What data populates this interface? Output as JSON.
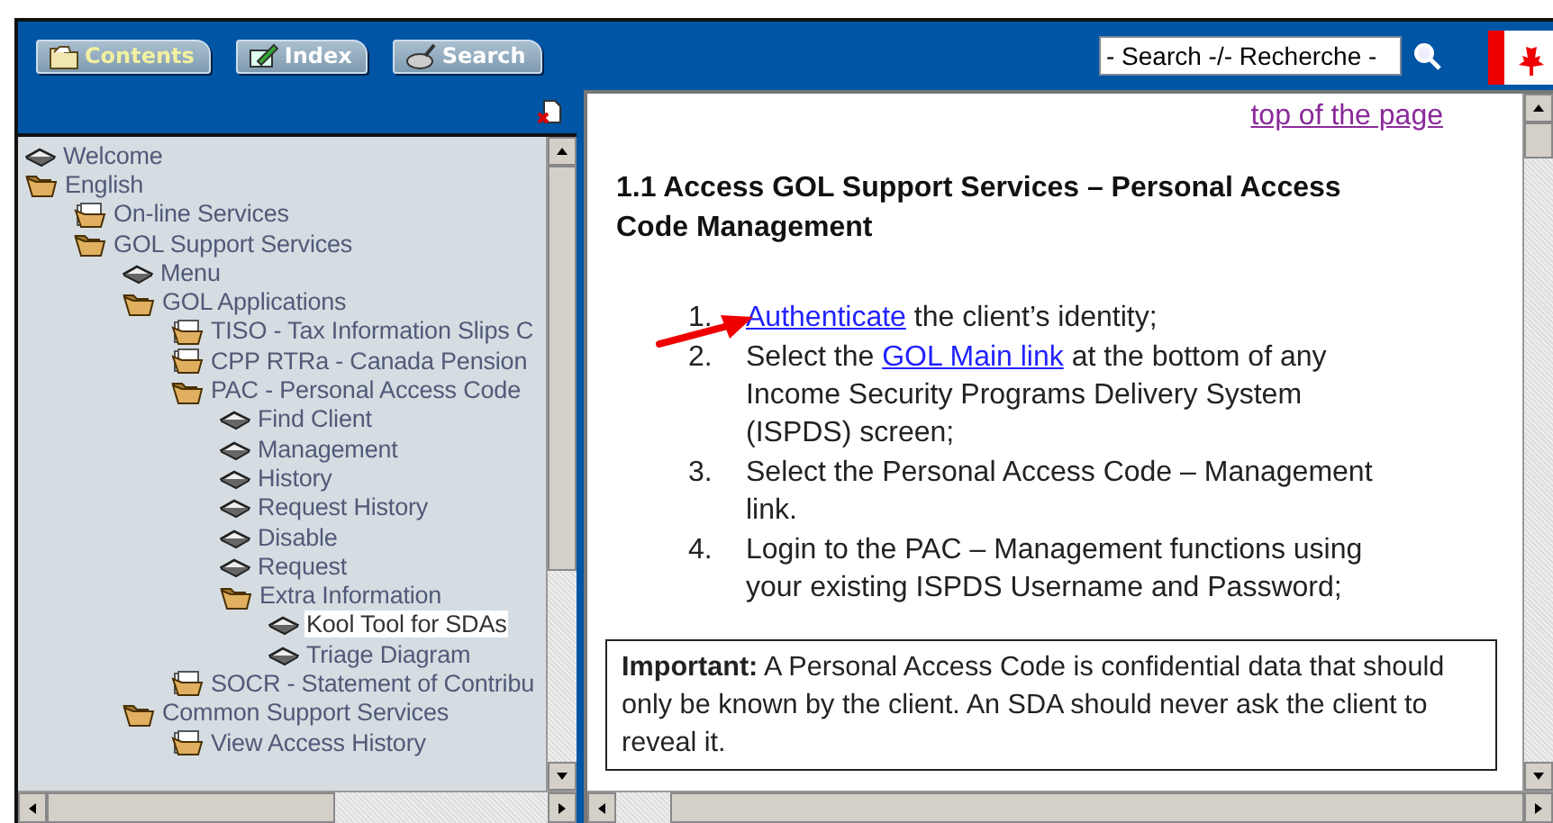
{
  "toolbar": {
    "tabs": [
      {
        "label": "Contents",
        "selected": true
      },
      {
        "label": "Index",
        "selected": false
      },
      {
        "label": "Search",
        "selected": false
      }
    ],
    "search": {
      "value": "- Search -/- Recherche -"
    }
  },
  "sidebar": {
    "tree": [
      {
        "label": "Welcome",
        "kind": "page",
        "selected": false
      },
      {
        "label": "English",
        "kind": "folder",
        "expanded": true,
        "selected": false,
        "children": [
          {
            "label": "On-line Services",
            "kind": "folder",
            "expanded": false,
            "selected": false
          },
          {
            "label": "GOL Support Services",
            "kind": "folder",
            "expanded": true,
            "selected": false,
            "children": [
              {
                "label": "Menu",
                "kind": "page",
                "selected": false
              },
              {
                "label": "GOL Applications",
                "kind": "folder",
                "expanded": true,
                "selected": false,
                "children": [
                  {
                    "label": "TISO - Tax Information Slips C",
                    "kind": "folder",
                    "expanded": false,
                    "selected": false
                  },
                  {
                    "label": "CPP RTRa - Canada Pension",
                    "kind": "folder",
                    "expanded": false,
                    "selected": false
                  },
                  {
                    "label": "PAC - Personal Access Code",
                    "kind": "folder",
                    "expanded": true,
                    "selected": false,
                    "children": [
                      {
                        "label": "Find Client",
                        "kind": "page",
                        "selected": false
                      },
                      {
                        "label": "Management",
                        "kind": "page",
                        "selected": false
                      },
                      {
                        "label": "History",
                        "kind": "page",
                        "selected": false
                      },
                      {
                        "label": "Request History",
                        "kind": "page",
                        "selected": false
                      },
                      {
                        "label": "Disable",
                        "kind": "page",
                        "selected": false
                      },
                      {
                        "label": "Request",
                        "kind": "page",
                        "selected": false
                      },
                      {
                        "label": "Extra Information",
                        "kind": "folder",
                        "expanded": true,
                        "selected": false,
                        "children": [
                          {
                            "label": "Kool Tool for SDAs",
                            "kind": "page",
                            "selected": true
                          },
                          {
                            "label": "Triage Diagram",
                            "kind": "page",
                            "selected": false
                          }
                        ]
                      }
                    ]
                  },
                  {
                    "label": "SOCR - Statement of Contribu",
                    "kind": "folder",
                    "expanded": false,
                    "selected": false
                  }
                ]
              },
              {
                "label": "Common Support Services",
                "kind": "folder",
                "expanded": true,
                "selected": false,
                "children": [
                  {
                    "label": "View Access History",
                    "kind": "folder",
                    "expanded": false,
                    "selected": false
                  }
                ]
              }
            ]
          }
        ]
      }
    ]
  },
  "content": {
    "top_link": "top of the page",
    "heading": "1.1 Access GOL Support Services – Personal Access Code Management",
    "steps": [
      {
        "number": "1.",
        "parts": [
          {
            "kind": "link",
            "text": "Authenticate"
          },
          {
            "kind": "text",
            "text": " the client’s identity;"
          }
        ]
      },
      {
        "number": "2.",
        "parts": [
          {
            "kind": "text",
            "text": "Select the "
          },
          {
            "kind": "link",
            "text": "GOL Main link"
          },
          {
            "kind": "text",
            "text": " at the bottom of any Income Security Programs Delivery System (ISPDS) screen;"
          }
        ]
      },
      {
        "number": "3.",
        "parts": [
          {
            "kind": "text",
            "text": "Select the Personal Access Code – Management link."
          }
        ]
      },
      {
        "number": "4.",
        "parts": [
          {
            "kind": "text",
            "text": "Login to the PAC – Management functions using your existing ISPDS Username and Password;"
          }
        ]
      }
    ],
    "important": "**Important:**  A Personal Access Code is confidential data that should only be known by the client. An SDA should never ask the client to reveal it."
  }
}
